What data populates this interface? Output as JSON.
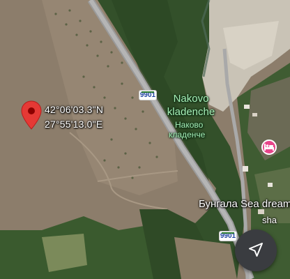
{
  "marker": {
    "latitude": "42°06'03.3\"N",
    "longitude": "27°55'13.0\"E",
    "color": "#e53935"
  },
  "road_shields": [
    "9901",
    "9901"
  ],
  "poi": {
    "name_en_line1": "Nakovo",
    "name_en_line2": "kladenche",
    "name_bg_line1": "Наково",
    "name_bg_line2": "кладенче",
    "text_color": "#a8f0b8"
  },
  "lodging": {
    "label": "Бунгала Sea dream",
    "truncated_label": "sha",
    "icon": "hotel-bed-icon",
    "color": "#e7458a"
  },
  "controls": {
    "navigate_icon": "navigation-arrow-icon"
  }
}
